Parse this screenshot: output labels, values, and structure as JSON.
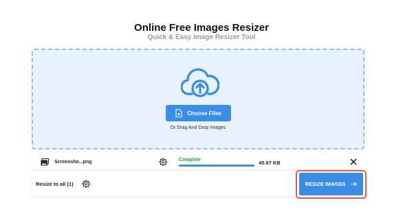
{
  "header": {
    "title": "Online Free Images Resizer",
    "subtitle": "Quick & Easy Image Resizer Tool"
  },
  "dropzone": {
    "icon": "cloud-upload-icon",
    "choose_label": "Choose Files",
    "drag_text": "Or Drag And Drop Images"
  },
  "files": [
    {
      "name": "Screensho...png",
      "status": "Complete",
      "progress": 1.0,
      "size": "45.97 KB"
    }
  ],
  "footer": {
    "resize_all_label": "Resize to all (1)",
    "resize_button_label": "RESIZE IMAGES"
  },
  "colors": {
    "accent": "#3b8ee8",
    "dropzone_bg": "#e8f2fc",
    "dropzone_border": "#8cc0ef",
    "complete": "#2e9a3a",
    "highlight": "#e05a5a"
  }
}
